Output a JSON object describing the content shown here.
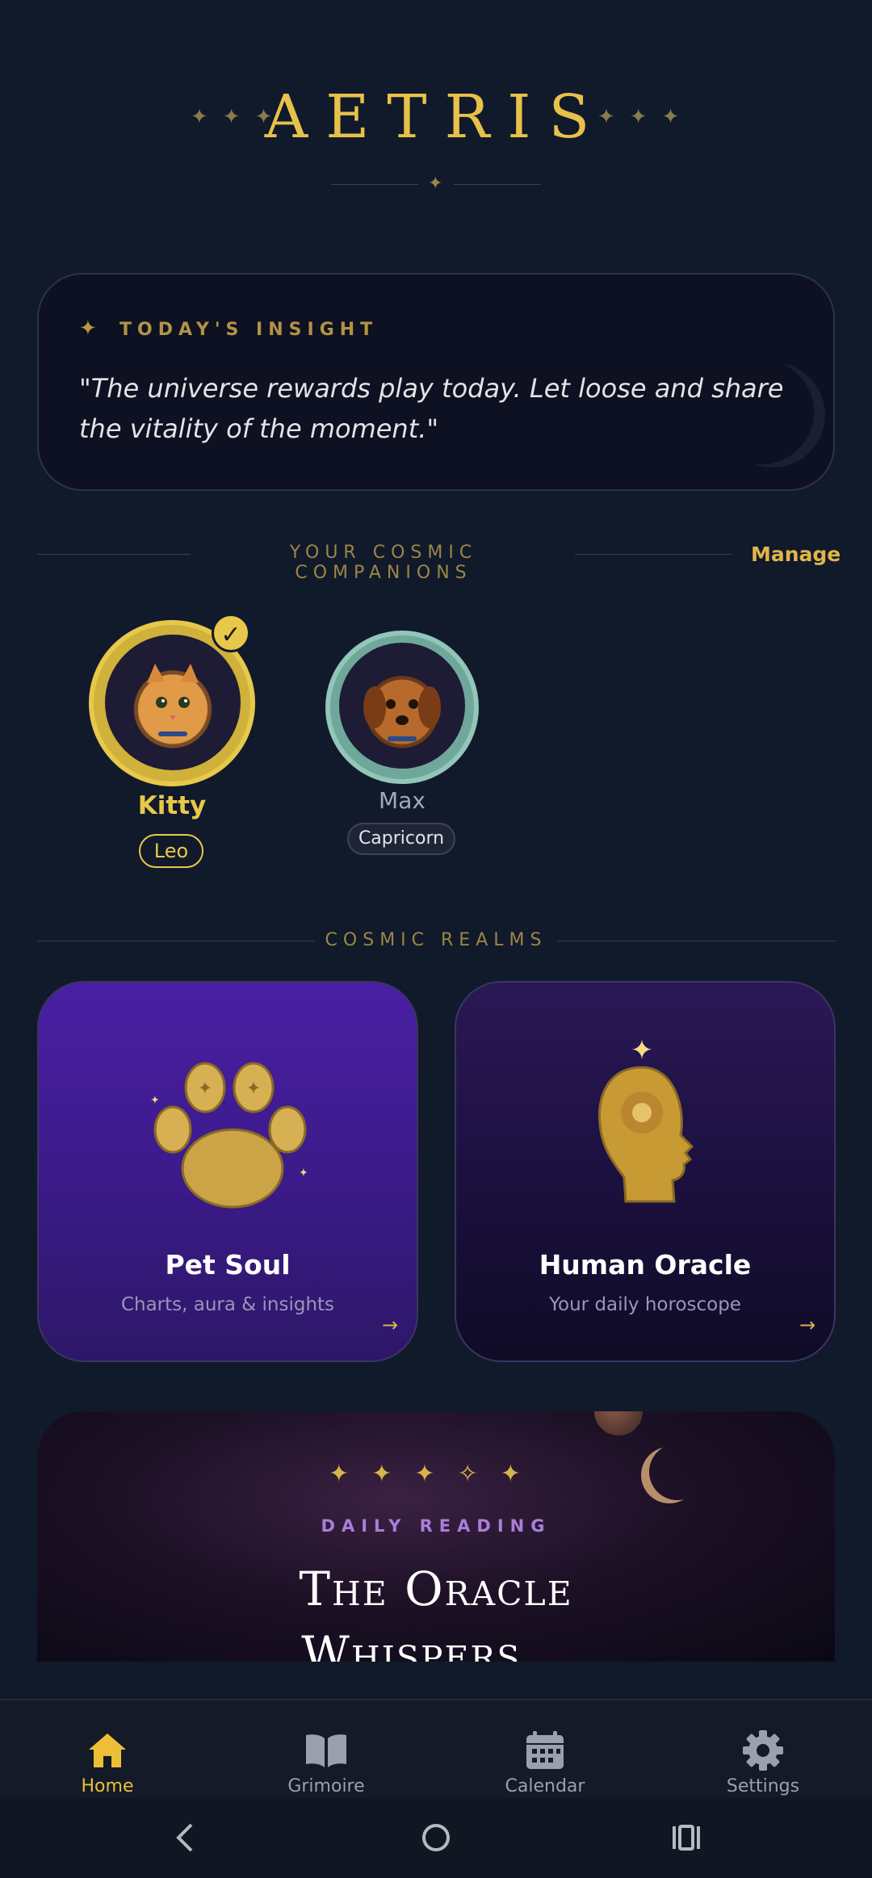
{
  "header": {
    "logo": "AETRIS",
    "stars_left": "✦✦✦",
    "stars_right": "✦✦✦",
    "divider_star": "✦"
  },
  "insight": {
    "icon": "sparkle-icon",
    "title": "TODAY'S INSIGHT",
    "text": "\"The universe rewards play today. Let loose and share the vitality of the moment.\""
  },
  "companions": {
    "title": "YOUR COSMIC COMPANIONS",
    "manage_label": "Manage",
    "pets": [
      {
        "name": "Kitty",
        "sign": "Leo",
        "selected": true,
        "check": "✓"
      },
      {
        "name": "Max",
        "sign": "Capricorn",
        "selected": false
      }
    ]
  },
  "realms": {
    "title": "COSMIC REALMS",
    "cards": [
      {
        "name": "Pet Soul",
        "subtitle": "Charts, aura & insights",
        "arrow": "→"
      },
      {
        "name": "Human Oracle",
        "subtitle": "Your daily horoscope",
        "arrow": "→"
      }
    ]
  },
  "oracle": {
    "stars": "✦✦✦✧✦",
    "label": "DAILY READING",
    "title_line1": "The Oracle",
    "title_line2": "Whispers..."
  },
  "nav": {
    "items": [
      {
        "label": "Home",
        "icon": "home-icon",
        "active": true
      },
      {
        "label": "Grimoire",
        "icon": "book-icon",
        "active": false
      },
      {
        "label": "Calendar",
        "icon": "calendar-icon",
        "active": false
      },
      {
        "label": "Settings",
        "icon": "gear-icon",
        "active": false
      }
    ]
  },
  "colors": {
    "background": "#111a2b",
    "gold": "#e8c84a",
    "accent_purple": "#4a1fa4",
    "teal_ring": "#92c6b8"
  }
}
